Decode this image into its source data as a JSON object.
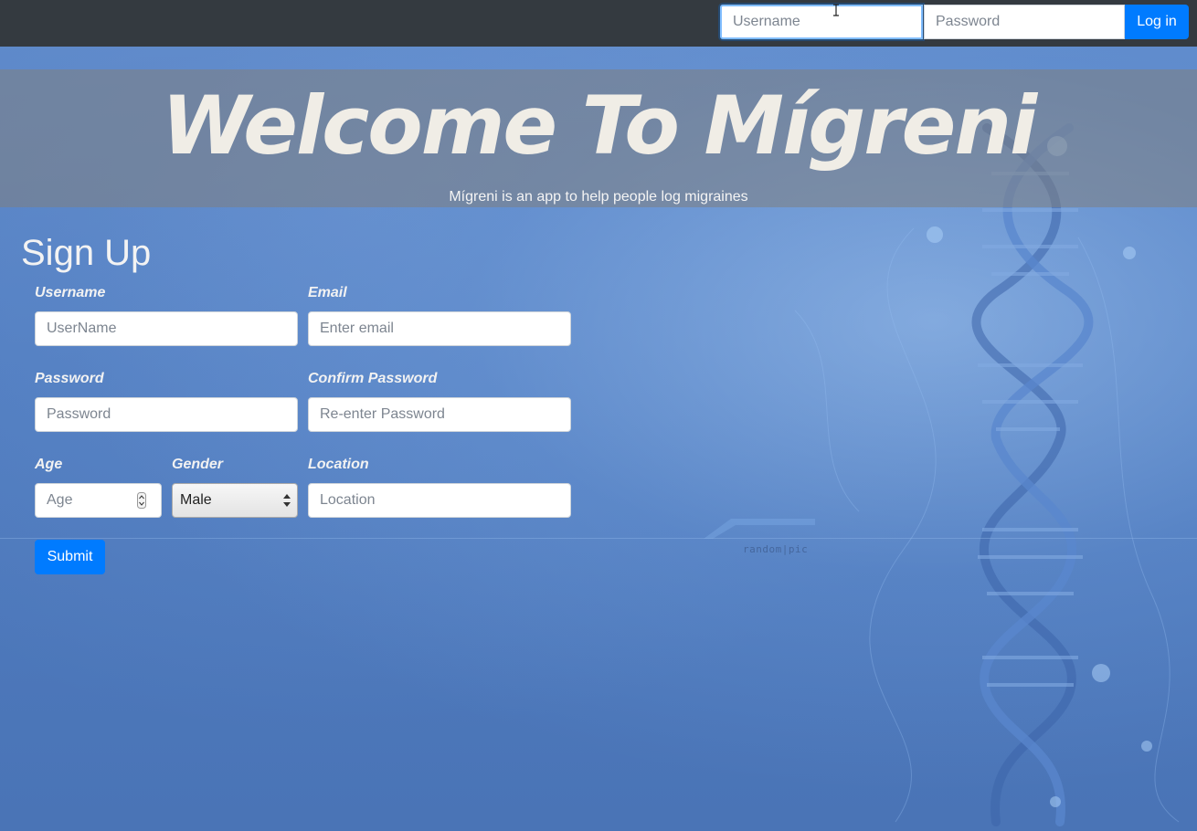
{
  "navbar": {
    "username_placeholder": "Username",
    "password_placeholder": "Password",
    "login_label": "Log in"
  },
  "hero": {
    "title": "Welcome To Mígreni",
    "subtitle": "Mígreni is an app to help people log migraines"
  },
  "signup": {
    "title": "Sign Up",
    "username": {
      "label": "Username",
      "placeholder": "UserName"
    },
    "email": {
      "label": "Email",
      "placeholder": "Enter email"
    },
    "password": {
      "label": "Password",
      "placeholder": "Password"
    },
    "confirm_password": {
      "label": "Confirm Password",
      "placeholder": "Re-enter Password"
    },
    "age": {
      "label": "Age",
      "placeholder": "Age"
    },
    "gender": {
      "label": "Gender",
      "selected": "Male"
    },
    "location": {
      "label": "Location",
      "placeholder": "Location"
    },
    "submit_label": "Submit"
  },
  "background": {
    "watermark": "random|pic"
  },
  "colors": {
    "navbar": "#343a40",
    "primary": "#007bff",
    "background": "#4a76b8"
  }
}
